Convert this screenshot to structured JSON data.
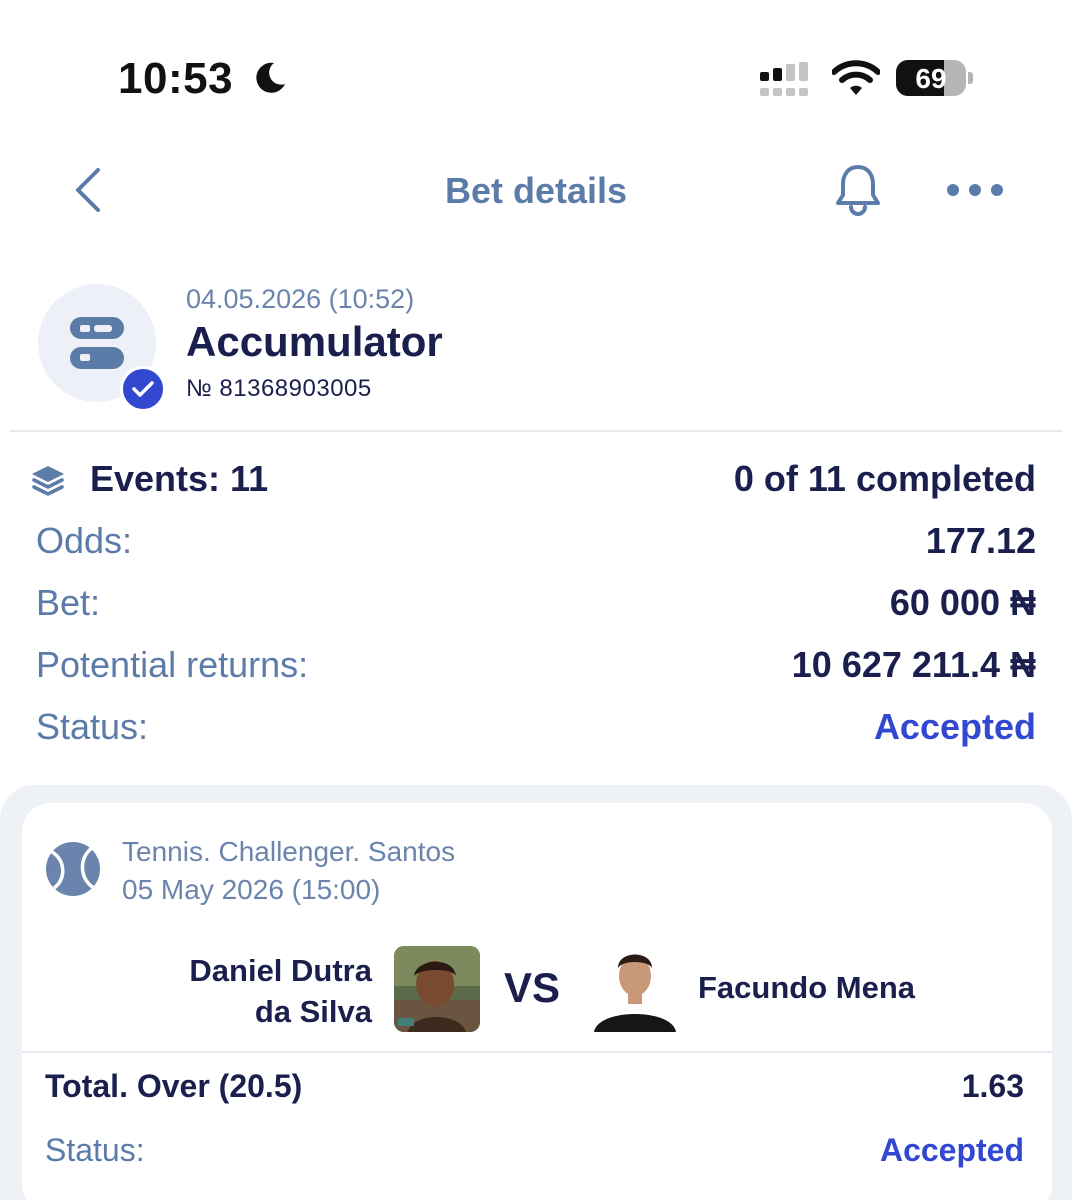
{
  "status_bar": {
    "time": "10:53",
    "battery": "69",
    "battery_level": 0.69
  },
  "nav": {
    "title": "Bet details"
  },
  "bet": {
    "date": "04.05.2026 (10:52)",
    "type": "Accumulator",
    "number": "№ 81368903005"
  },
  "summary": {
    "events_label": "Events: 11",
    "events_value": "0 of 11 completed",
    "odds_label": "Odds:",
    "odds_value": "177.12",
    "bet_label": "Bet:",
    "bet_value": "60 000 ₦",
    "returns_label": "Potential returns:",
    "returns_value": "10 627 211.4 ₦",
    "status_label": "Status:",
    "status_value": "Accepted"
  },
  "event": {
    "tournament": "Tennis. Challenger. Santos",
    "date": "05 May 2026 (15:00)",
    "player1_line1": "Daniel Dutra",
    "player1_line2": "da Silva",
    "vs": "VS",
    "player2": "Facundo Mena",
    "market": "Total. Over (20.5)",
    "odds": "1.63",
    "status_label": "Status:",
    "status_value": "Accepted"
  },
  "colors": {
    "accent": "#3248d1",
    "muted": "#5b7ba8",
    "text": "#1a1f4d",
    "panel": "#eef1f6"
  },
  "icons": [
    "moon-icon",
    "cellular-signal-icon",
    "wifi-icon",
    "battery-icon",
    "back-chevron-icon",
    "bell-icon",
    "more-icon",
    "accumulator-icon",
    "check-icon",
    "layers-icon",
    "tennis-ball-icon"
  ]
}
